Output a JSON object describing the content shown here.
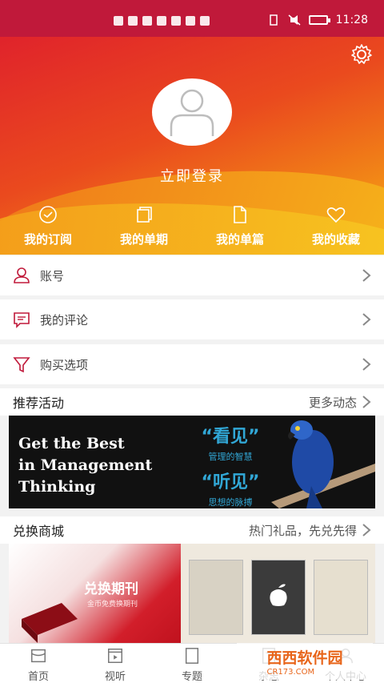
{
  "status_bar": {
    "time": "11:28"
  },
  "header": {
    "login_text": "立即登录"
  },
  "quick_actions": [
    {
      "label": "我的订阅",
      "icon": "check-circle-icon"
    },
    {
      "label": "我的单期",
      "icon": "copy-icon"
    },
    {
      "label": "我的单篇",
      "icon": "document-icon"
    },
    {
      "label": "我的收藏",
      "icon": "heart-icon"
    }
  ],
  "menu": [
    {
      "label": "账号",
      "icon": "user-icon"
    },
    {
      "label": "我的评论",
      "icon": "comment-icon"
    },
    {
      "label": "购买选项",
      "icon": "filter-icon"
    }
  ],
  "activities": {
    "title": "推荐活动",
    "more": "更多动态",
    "banner": {
      "line1": "Get the Best",
      "line2": "in Management",
      "line3": "Thinking",
      "cn_big1": "“看见”",
      "cn_small1": "管理的智慧",
      "cn_big2": "“听见”",
      "cn_small2": "思想的脉搏"
    }
  },
  "exchange": {
    "title": "兑换商城",
    "more": "热门礼品，先兑先得",
    "banner": {
      "title": "兑换期刊",
      "subtitle": "金币免费换期刊"
    }
  },
  "tabs": [
    {
      "label": "首页",
      "icon": "home-icon"
    },
    {
      "label": "视听",
      "icon": "video-icon"
    },
    {
      "label": "专题",
      "icon": "topic-icon"
    },
    {
      "label": "杂志",
      "icon": "magazine-icon"
    },
    {
      "label": "个人中心",
      "icon": "profile-icon"
    }
  ],
  "watermark": {
    "text": "西西软件园",
    "sub": "CR173.COM"
  },
  "colors": {
    "status_bar": "#c0193a",
    "gradient_start": "#e0232b",
    "gradient_end": "#f5c418"
  }
}
